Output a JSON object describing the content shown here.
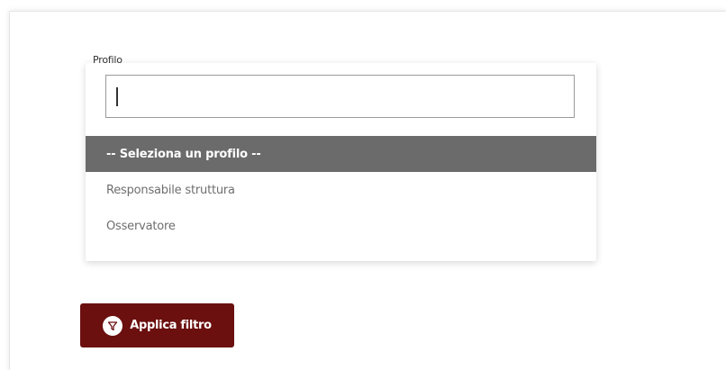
{
  "form": {
    "profile_label": "Profilo"
  },
  "search": {
    "value": "",
    "placeholder": ""
  },
  "dropdown": {
    "options": [
      {
        "label": "-- Seleziona un profilo --",
        "selected": true
      },
      {
        "label": "Responsabile struttura",
        "selected": false
      },
      {
        "label": "Osservatore",
        "selected": false
      }
    ]
  },
  "actions": {
    "apply_label": "Applica filtro"
  },
  "colors": {
    "brand": "#6b0f0f",
    "selected_option_bg": "#6b6b6b"
  },
  "icons": {
    "apply": "filter-icon"
  }
}
